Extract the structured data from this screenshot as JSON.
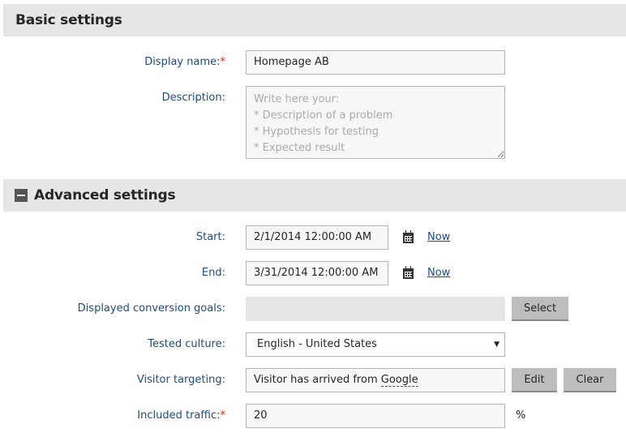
{
  "basic": {
    "title": "Basic settings",
    "display_name_label": "Display name:",
    "required_mark": "*",
    "display_name_value": "Homepage AB",
    "description_label": "Description:",
    "description_placeholder": "Write here your:\n* Description of a problem\n* Hypothesis for testing\n* Expected result"
  },
  "advanced": {
    "title": "Advanced settings",
    "start_label": "Start:",
    "start_value": "2/1/2014 12:00:00 AM",
    "end_label": "End:",
    "end_value": "3/31/2014 12:00:00 AM",
    "now_label": "Now",
    "goals_label": "Displayed conversion goals:",
    "goals_value": "",
    "select_button": "Select",
    "culture_label": "Tested culture:",
    "culture_value": "English - United States",
    "targeting_label": "Visitor targeting:",
    "targeting_value_prefix": "Visitor has arrived from ",
    "targeting_value_term": "Google",
    "edit_button": "Edit",
    "clear_button": "Clear",
    "traffic_label": "Included traffic:",
    "traffic_value": "20",
    "traffic_unit": "%"
  },
  "icons": {
    "collapse": "minus-square-icon",
    "calendar": "calendar-icon",
    "dropdown": "triangle-down-icon"
  },
  "colors": {
    "label": "#1e4d80",
    "required": "#d9261c",
    "header_bg": "#e6e6e6",
    "button_bg": "#bdbdbd"
  }
}
